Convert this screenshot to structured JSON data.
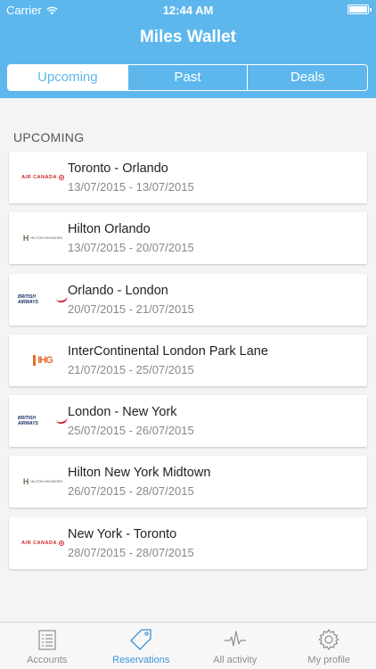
{
  "status": {
    "carrier": "Carrier",
    "time": "12:44 AM"
  },
  "header": {
    "title": "Miles Wallet"
  },
  "segments": [
    {
      "label": "Upcoming",
      "active": true
    },
    {
      "label": "Past",
      "active": false
    },
    {
      "label": "Deals",
      "active": false
    }
  ],
  "section_label": "UPCOMING",
  "reservations": [
    {
      "logo": "air-canada-logo",
      "logo_text": "AIR CANADA",
      "title": "Toronto - Orlando",
      "dates": "13/07/2015 - 13/07/2015"
    },
    {
      "logo": "hilton-hhonors-logo",
      "logo_text": "HILTON HHONORS",
      "title": "Hilton Orlando",
      "dates": "13/07/2015 - 20/07/2015"
    },
    {
      "logo": "british-airways-logo",
      "logo_text": "BRITISH AIRWAYS",
      "title": "Orlando - London",
      "dates": "20/07/2015 - 21/07/2015"
    },
    {
      "logo": "ihg-logo",
      "logo_text": "IHG",
      "title": "InterContinental London Park Lane",
      "dates": "21/07/2015 - 25/07/2015"
    },
    {
      "logo": "british-airways-logo",
      "logo_text": "BRITISH AIRWAYS",
      "title": "London - New York",
      "dates": "25/07/2015 - 26/07/2015"
    },
    {
      "logo": "hilton-hhonors-logo",
      "logo_text": "HILTON HHONORS",
      "title": "Hilton New York Midtown",
      "dates": "26/07/2015 - 28/07/2015"
    },
    {
      "logo": "air-canada-logo",
      "logo_text": "AIR CANADA",
      "title": "New York - Toronto",
      "dates": "28/07/2015 - 28/07/2015"
    }
  ],
  "tabs": [
    {
      "label": "Accounts",
      "icon": "list-icon",
      "active": false
    },
    {
      "label": "Reservations",
      "icon": "tag-icon",
      "active": true
    },
    {
      "label": "All activity",
      "icon": "activity-icon",
      "active": false
    },
    {
      "label": "My profile",
      "icon": "gear-icon",
      "active": false
    }
  ],
  "colors": {
    "accent": "#5db7ed",
    "tab_active": "#3e94d6"
  }
}
